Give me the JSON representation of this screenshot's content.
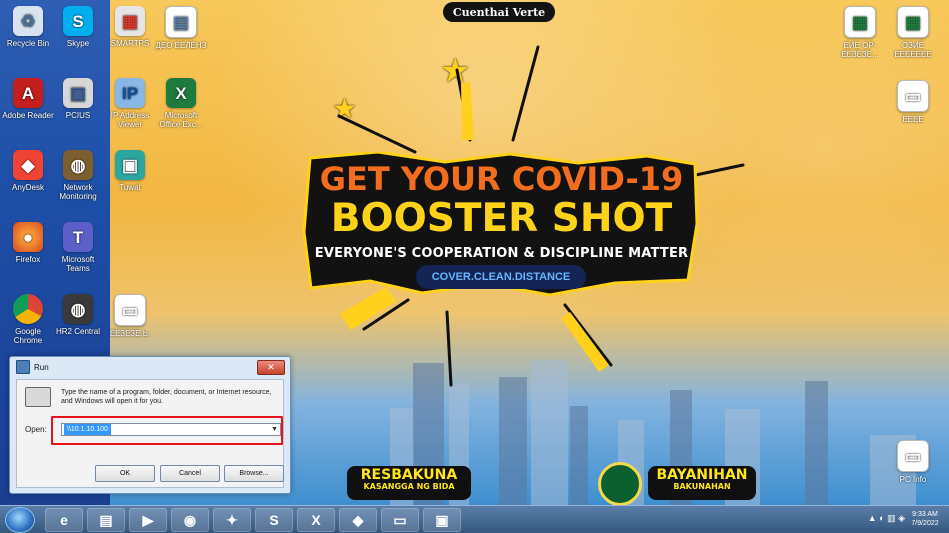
{
  "brand": {
    "top_logo": "Cuenthai Verte"
  },
  "poster": {
    "line1": "GET YOUR COVID-19",
    "line2": "BOOSTER SHOT",
    "line3": "EVERYONE'S COOPERATION & DISCIPLINE MATTER",
    "line4": "COVER.CLEAN.DISTANCE",
    "logo_left": {
      "big": "RESBAKUNA",
      "small": "KASANGGA NG BIDA"
    },
    "logo_right": {
      "big": "BAYANIHAN",
      "small": "BAKUNAHAN"
    }
  },
  "desktop": {
    "left_icons": [
      {
        "label": "Recycle Bin",
        "icon": "recycle-bin-icon"
      },
      {
        "label": "Skype",
        "icon": "skype-icon"
      },
      {
        "label": "SMARTPS",
        "icon": "smartps-icon"
      },
      {
        "label": "ДЕО ЕЕЛЕНЗ",
        "icon": "document-icon"
      },
      {
        "label": "Adobe Reader",
        "icon": "acrobat-icon"
      },
      {
        "label": "PCIUS",
        "icon": "network-icon"
      },
      {
        "label": "IP Address Viewer",
        "icon": "ip-address-icon"
      },
      {
        "label": "Microsoft Office Exc...",
        "icon": "excel-icon"
      },
      {
        "label": "AnyDesk",
        "icon": "anydesk-icon"
      },
      {
        "label": "Network Monitoring",
        "icon": "globe-icon"
      },
      {
        "label": "Tuwat",
        "icon": "teal-box-icon"
      },
      {
        "label": "Firefox",
        "icon": "firefox-icon"
      },
      {
        "label": "Microsoft Teams",
        "icon": "teams-icon"
      },
      {
        "label": "Google Chrome",
        "icon": "chrome-icon"
      },
      {
        "label": "HR2 Central",
        "icon": "hr-icon"
      },
      {
        "label": "ЕЕЗЕЗЕ.Ь.",
        "icon": "file-icon"
      }
    ],
    "right_icons": [
      {
        "label": "ЕИЕ ОР-ЕЕЗЕЗЕ...",
        "icon": "excel-file-icon"
      },
      {
        "label": "ОЗИЕ ЕЕЕЕЕЕЕ",
        "icon": "excel-file-icon"
      },
      {
        "label": "ЕЕЕЕ",
        "icon": "file-icon"
      },
      {
        "label": "PC Info",
        "icon": "file-icon"
      }
    ]
  },
  "run_dialog": {
    "title": "Run",
    "description": "Type the name of a program, folder, document, or Internet resource, and Windows will open it for you.",
    "open_label": "Open:",
    "input_value": "\\\\10.1.10.100",
    "buttons": {
      "ok": "OK",
      "cancel": "Cancel",
      "browse": "Browse..."
    }
  },
  "taskbar": {
    "apps": [
      {
        "name": "ie-icon",
        "label": "e"
      },
      {
        "name": "folder-icon",
        "label": "▤"
      },
      {
        "name": "media-icon",
        "label": "▶"
      },
      {
        "name": "chrome-icon",
        "label": "◉"
      },
      {
        "name": "tool-icon",
        "label": "✦"
      },
      {
        "name": "skype-icon",
        "label": "S"
      },
      {
        "name": "excel-icon",
        "label": "X"
      },
      {
        "name": "anydesk-icon",
        "label": "◆"
      },
      {
        "name": "window-icon",
        "label": "▭"
      },
      {
        "name": "monitor-icon",
        "label": "▣"
      }
    ],
    "tray": "▲ ◐ ▥ ◈",
    "time": "9:33 AM",
    "date": "7/9/2022"
  },
  "colors": {
    "accent_orange": "#f26d1f",
    "accent_yellow": "#ffd21a",
    "run_highlight": "#e3141c"
  }
}
